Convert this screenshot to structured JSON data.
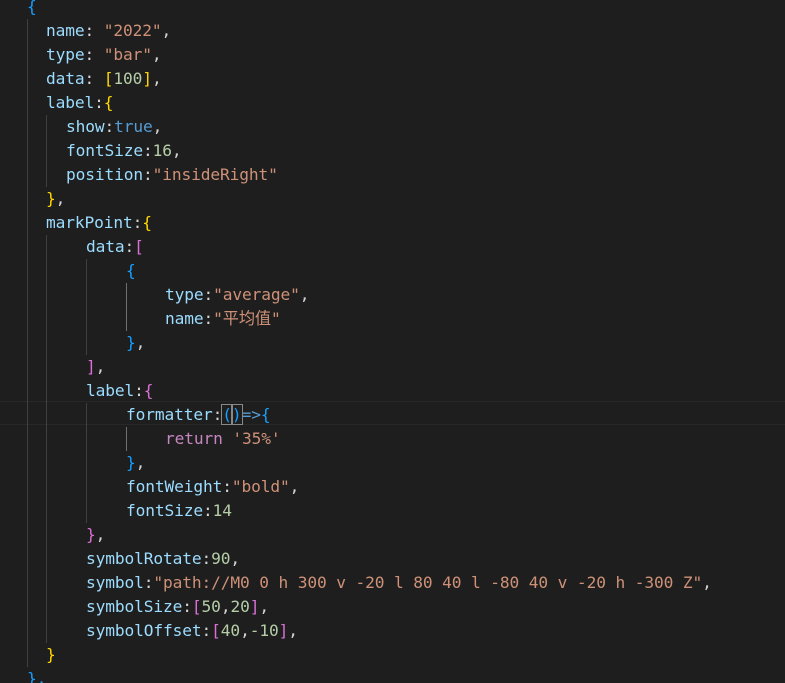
{
  "editor": {
    "theme": "dark",
    "colors": {
      "background": "#1e1e1e",
      "property": "#9cdcfe",
      "string": "#ce9178",
      "number": "#b5cea8",
      "keyword": "#569cd6",
      "control_keyword": "#c586c0",
      "punctuation": "#d4d4d4",
      "bracket_level_1": "#ffd700",
      "bracket_level_2": "#da70d6",
      "bracket_level_3": "#179fff"
    },
    "lines": [
      [
        {
          "t": "{",
          "c": "b3"
        }
      ],
      [
        {
          "t": "name",
          "c": "p"
        },
        {
          "t": ": ",
          "c": "pu"
        },
        {
          "t": "\"2022\"",
          "c": "s"
        },
        {
          "t": ",",
          "c": "pu"
        }
      ],
      [
        {
          "t": "type",
          "c": "p"
        },
        {
          "t": ": ",
          "c": "pu"
        },
        {
          "t": "\"bar\"",
          "c": "s"
        },
        {
          "t": ",",
          "c": "pu"
        }
      ],
      [
        {
          "t": "data",
          "c": "p"
        },
        {
          "t": ": ",
          "c": "pu"
        },
        {
          "t": "[",
          "c": "b1"
        },
        {
          "t": "100",
          "c": "n"
        },
        {
          "t": "]",
          "c": "b1"
        },
        {
          "t": ",",
          "c": "pu"
        }
      ],
      [
        {
          "t": "label",
          "c": "p"
        },
        {
          "t": ":",
          "c": "pu"
        },
        {
          "t": "{",
          "c": "b1"
        }
      ],
      [
        {
          "t": "show",
          "c": "p"
        },
        {
          "t": ":",
          "c": "pu"
        },
        {
          "t": "true",
          "c": "k"
        },
        {
          "t": ",",
          "c": "pu"
        }
      ],
      [
        {
          "t": "fontSize",
          "c": "p"
        },
        {
          "t": ":",
          "c": "pu"
        },
        {
          "t": "16",
          "c": "n"
        },
        {
          "t": ",",
          "c": "pu"
        }
      ],
      [
        {
          "t": "position",
          "c": "p"
        },
        {
          "t": ":",
          "c": "pu"
        },
        {
          "t": "\"insideRight\"",
          "c": "s"
        }
      ],
      [
        {
          "t": "}",
          "c": "b1"
        },
        {
          "t": ",",
          "c": "pu"
        }
      ],
      [
        {
          "t": "markPoint",
          "c": "p"
        },
        {
          "t": ":",
          "c": "pu"
        },
        {
          "t": "{",
          "c": "b1"
        }
      ],
      [
        {
          "t": "data",
          "c": "p"
        },
        {
          "t": ":",
          "c": "pu"
        },
        {
          "t": "[",
          "c": "b2"
        }
      ],
      [
        {
          "t": "{",
          "c": "b3"
        }
      ],
      [
        {
          "t": "type",
          "c": "p"
        },
        {
          "t": ":",
          "c": "pu"
        },
        {
          "t": "\"average\"",
          "c": "s"
        },
        {
          "t": ",",
          "c": "pu"
        }
      ],
      [
        {
          "t": "name",
          "c": "p"
        },
        {
          "t": ":",
          "c": "pu"
        },
        {
          "t": "\"平均值\"",
          "c": "s"
        }
      ],
      [
        {
          "t": "}",
          "c": "b3"
        },
        {
          "t": ",",
          "c": "pu"
        }
      ],
      [
        {
          "t": "]",
          "c": "b2"
        },
        {
          "t": ",",
          "c": "pu"
        }
      ],
      [
        {
          "t": "label",
          "c": "p"
        },
        {
          "t": ":",
          "c": "pu"
        },
        {
          "t": "{",
          "c": "b2"
        }
      ],
      [
        {
          "t": "formatter",
          "c": "p"
        },
        {
          "t": ":",
          "c": "pu"
        },
        {
          "t": "(",
          "c": "b3",
          "box": true
        },
        {
          "t": ")",
          "c": "b3",
          "box": true
        },
        {
          "t": "=>",
          "c": "k"
        },
        {
          "t": "{",
          "c": "b3"
        }
      ],
      [
        {
          "t": "return",
          "c": "c"
        },
        {
          "t": " ",
          "c": "pu"
        },
        {
          "t": "'35%'",
          "c": "s"
        }
      ],
      [
        {
          "t": "}",
          "c": "b3"
        },
        {
          "t": ",",
          "c": "pu"
        }
      ],
      [
        {
          "t": "fontWeight",
          "c": "p"
        },
        {
          "t": ":",
          "c": "pu"
        },
        {
          "t": "\"bold\"",
          "c": "s"
        },
        {
          "t": ",",
          "c": "pu"
        }
      ],
      [
        {
          "t": "fontSize",
          "c": "p"
        },
        {
          "t": ":",
          "c": "pu"
        },
        {
          "t": "14",
          "c": "n"
        }
      ],
      [
        {
          "t": "}",
          "c": "b2"
        },
        {
          "t": ",",
          "c": "pu"
        }
      ],
      [
        {
          "t": "symbolRotate",
          "c": "p"
        },
        {
          "t": ":",
          "c": "pu"
        },
        {
          "t": "90",
          "c": "n"
        },
        {
          "t": ",",
          "c": "pu"
        }
      ],
      [
        {
          "t": "symbol",
          "c": "p"
        },
        {
          "t": ":",
          "c": "pu"
        },
        {
          "t": "\"path://M0 0 h 300 v -20 l 80 40 l -80 40 v -20 h -300 Z\"",
          "c": "s"
        },
        {
          "t": ",",
          "c": "pu"
        }
      ],
      [
        {
          "t": "symbolSize",
          "c": "p"
        },
        {
          "t": ":",
          "c": "pu"
        },
        {
          "t": "[",
          "c": "b2"
        },
        {
          "t": "50",
          "c": "n"
        },
        {
          "t": ",",
          "c": "pu"
        },
        {
          "t": "20",
          "c": "n"
        },
        {
          "t": "]",
          "c": "b2"
        },
        {
          "t": ",",
          "c": "pu"
        }
      ],
      [
        {
          "t": "symbolOffset",
          "c": "p"
        },
        {
          "t": ":",
          "c": "pu"
        },
        {
          "t": "[",
          "c": "b2"
        },
        {
          "t": "40",
          "c": "n"
        },
        {
          "t": ",",
          "c": "pu"
        },
        {
          "t": "-10",
          "c": "n"
        },
        {
          "t": "]",
          "c": "b2"
        },
        {
          "t": ",",
          "c": "pu"
        }
      ],
      [
        {
          "t": "}",
          "c": "b1"
        }
      ],
      [
        {
          "t": "},",
          "c": "b3"
        }
      ]
    ]
  }
}
